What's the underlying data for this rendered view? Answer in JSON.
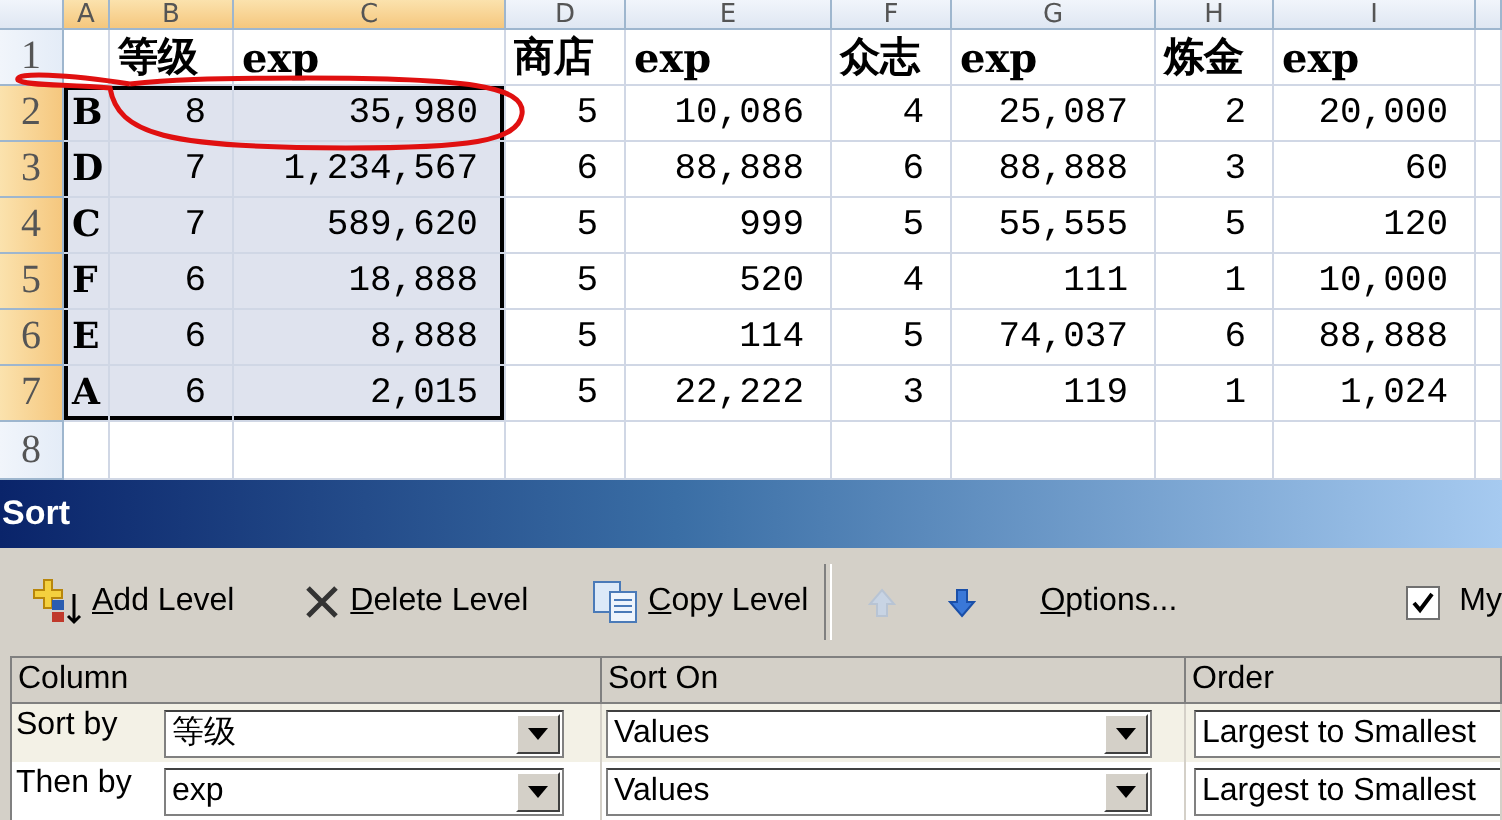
{
  "sheet": {
    "columns": [
      {
        "label": "A",
        "selected": true
      },
      {
        "label": "B",
        "selected": true
      },
      {
        "label": "C",
        "selected": true
      },
      {
        "label": "D",
        "selected": false
      },
      {
        "label": "E",
        "selected": false
      },
      {
        "label": "F",
        "selected": false
      },
      {
        "label": "G",
        "selected": false
      },
      {
        "label": "H",
        "selected": false
      },
      {
        "label": "I",
        "selected": false
      }
    ],
    "rows": [
      {
        "label": "1",
        "kind": "header",
        "selected": false,
        "cells": [
          null,
          "等级",
          "exp",
          "商店",
          "exp",
          "众志",
          "exp",
          "炼金",
          "exp"
        ]
      },
      {
        "label": "2",
        "kind": "data",
        "selected": true,
        "cells": [
          "B",
          "8",
          "35,980",
          "5",
          "10,086",
          "4",
          "25,087",
          "2",
          "20,000"
        ]
      },
      {
        "label": "3",
        "kind": "data",
        "selected": true,
        "cells": [
          "D",
          "7",
          "1,234,567",
          "6",
          "88,888",
          "6",
          "88,888",
          "3",
          "60"
        ]
      },
      {
        "label": "4",
        "kind": "data",
        "selected": true,
        "cells": [
          "C",
          "7",
          "589,620",
          "5",
          "999",
          "5",
          "55,555",
          "5",
          "120"
        ]
      },
      {
        "label": "5",
        "kind": "data",
        "selected": true,
        "cells": [
          "F",
          "6",
          "18,888",
          "5",
          "520",
          "4",
          "111",
          "1",
          "10,000"
        ]
      },
      {
        "label": "6",
        "kind": "data",
        "selected": true,
        "cells": [
          "E",
          "6",
          "8,888",
          "5",
          "114",
          "5",
          "74,037",
          "6",
          "88,888"
        ]
      },
      {
        "label": "7",
        "kind": "data",
        "selected": true,
        "cells": [
          "A",
          "6",
          "2,015",
          "5",
          "22,222",
          "3",
          "119",
          "1",
          "1,024"
        ]
      },
      {
        "label": "8",
        "selected": false
      }
    ]
  },
  "dialog": {
    "title": "Sort",
    "toolbar": [
      {
        "kind": "add",
        "label": "Add Level",
        "disabled": false
      },
      {
        "kind": "delete",
        "label": "Delete Level",
        "disabled": false
      },
      {
        "kind": "copy",
        "label": "Copy Level",
        "disabled": false
      },
      {
        "kind": "separator"
      },
      {
        "kind": "move_up",
        "disabled": true
      },
      {
        "kind": "move_down",
        "disabled": false
      },
      {
        "kind": "options",
        "label": "Options...",
        "disabled": false
      },
      {
        "kind": "checkbox",
        "label": "My",
        "checked": true
      }
    ],
    "grid": {
      "columns": [
        "Column",
        "Sort On",
        "Order"
      ],
      "levels": [
        {
          "label": "Sort by",
          "column": "等级",
          "sort_on": "Values",
          "order": "Largest to Smallest",
          "selected": true
        },
        {
          "label": "Then by",
          "column": "exp",
          "sort_on": "Values",
          "order": "Largest to Smallest",
          "selected": false
        }
      ]
    }
  }
}
